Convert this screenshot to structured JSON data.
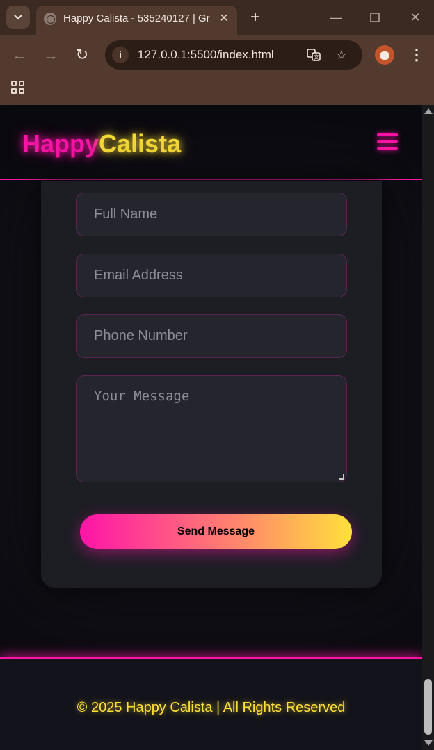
{
  "browser": {
    "tab_title": "Happy Calista - 535240127 | Gr",
    "url": "127.0.0.1:5500/index.html",
    "icons": {
      "tab_search": "chevron-down-icon",
      "close_tab": "close-icon",
      "new_tab": "plus-icon",
      "minimize": "minimize-icon",
      "maximize": "maximize-icon",
      "close_window": "close-icon",
      "back": "arrow-left-icon",
      "forward": "arrow-right-icon",
      "reload": "reload-icon",
      "site_info": "info-icon",
      "translate": "translate-icon",
      "bookmark": "star-icon",
      "menu": "kebab-menu-icon",
      "apps": "apps-grid-icon"
    }
  },
  "site": {
    "logo_part1": "Happy",
    "logo_part2": "Calista",
    "accent_pink": "#ff14a8",
    "accent_yellow": "#ffe236",
    "menu_icon": "hamburger-icon"
  },
  "form": {
    "name_placeholder": "Full Name",
    "email_placeholder": "Email Address",
    "phone_placeholder": "Phone Number",
    "message_placeholder": "Your Message",
    "submit_label": "Send Message"
  },
  "footer": {
    "copyright": "© 2025 Happy Calista | All Rights Reserved"
  }
}
